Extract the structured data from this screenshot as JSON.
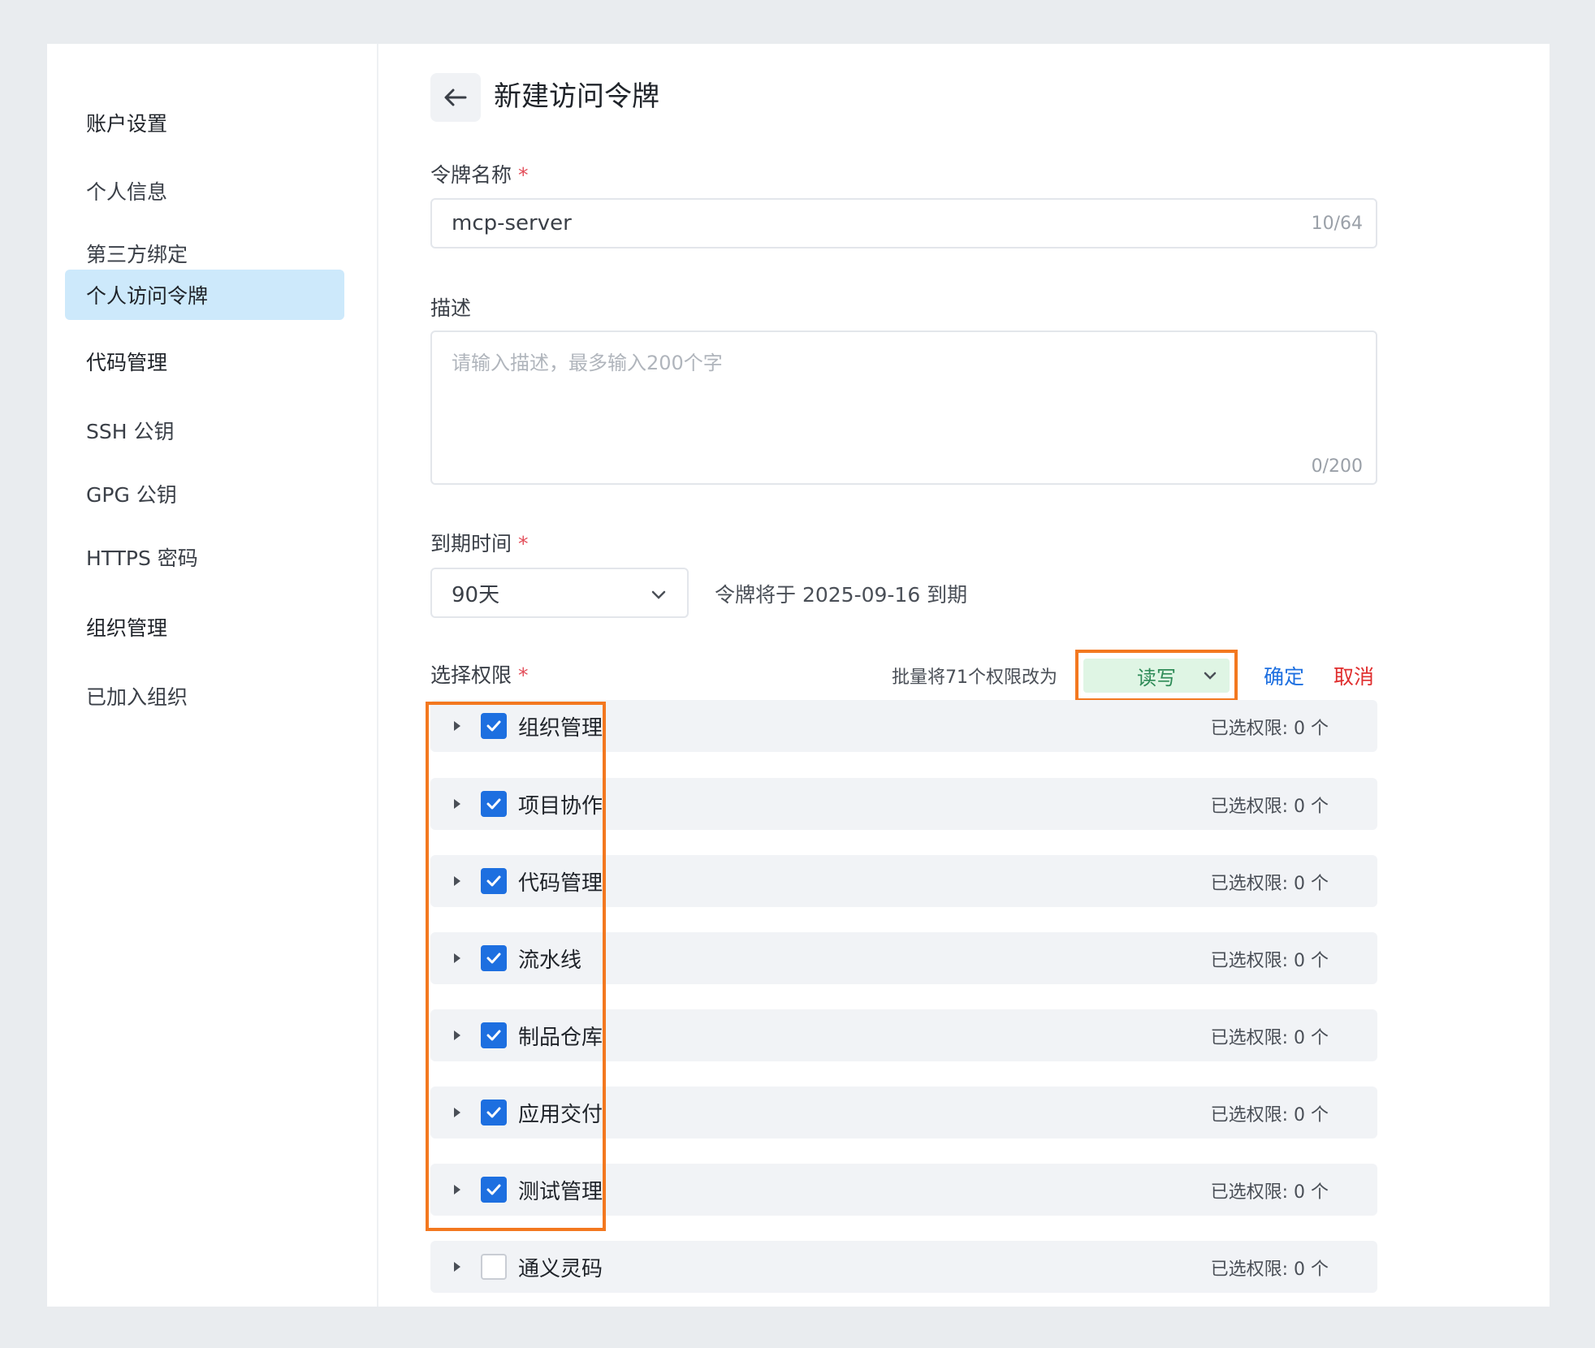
{
  "sidebar": {
    "items": [
      {
        "label": "账户设置",
        "group": true
      },
      {
        "label": "个人信息"
      },
      {
        "label": "第三方绑定"
      },
      {
        "label": "个人访问令牌",
        "active": true
      },
      {
        "label": "代码管理",
        "group": true
      },
      {
        "label": "SSH 公钥"
      },
      {
        "label": "GPG 公钥"
      },
      {
        "label": "HTTPS 密码"
      },
      {
        "label": "组织管理",
        "group": true
      },
      {
        "label": "已加入组织"
      }
    ]
  },
  "header": {
    "title": "新建访问令牌",
    "back_icon": "arrow-left-icon"
  },
  "form": {
    "token_name": {
      "label": "令牌名称",
      "required_mark": "*",
      "value": "mcp-server",
      "counter": "10/64"
    },
    "description": {
      "label": "描述",
      "placeholder": "请输入描述，最多输入200个字",
      "counter": "0/200"
    },
    "expiry": {
      "label": "到期时间",
      "required_mark": "*",
      "value": "90天",
      "note": "令牌将于 2025-09-16 到期"
    },
    "permissions": {
      "label": "选择权限",
      "required_mark": "*",
      "batch_label": "批量将71个权限改为",
      "batch_value": "读写",
      "confirm_label": "确定",
      "cancel_label": "取消",
      "rows": [
        {
          "name": "组织管理",
          "checked": true,
          "count": "已选权限: 0 个"
        },
        {
          "name": "项目协作",
          "checked": true,
          "count": "已选权限: 0 个"
        },
        {
          "name": "代码管理",
          "checked": true,
          "count": "已选权限: 0 个"
        },
        {
          "name": "流水线",
          "checked": true,
          "count": "已选权限: 0 个"
        },
        {
          "name": "制品仓库",
          "checked": true,
          "count": "已选权限: 0 个"
        },
        {
          "name": "应用交付",
          "checked": true,
          "count": "已选权限: 0 个"
        },
        {
          "name": "测试管理",
          "checked": true,
          "count": "已选权限: 0 个"
        },
        {
          "name": "通义灵码",
          "checked": false,
          "count": "已选权限: 0 个"
        }
      ]
    }
  },
  "colors": {
    "accent": "#1d6fe0",
    "highlight": "#f3781f",
    "active_bg": "#cde9fb",
    "danger": "#e02e2e",
    "rw_bg": "#dff5e4"
  }
}
